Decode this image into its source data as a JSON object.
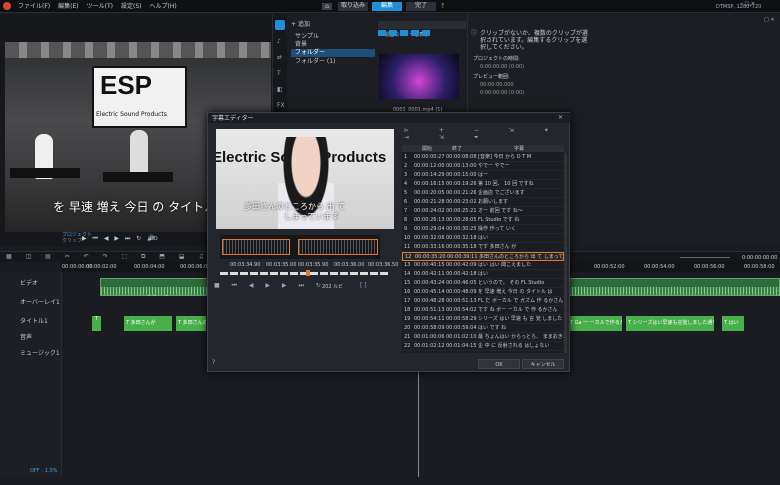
{
  "menu": {
    "items": [
      "ファイル(F)",
      "編集(E)",
      "ツール(T)",
      "設定(S)",
      "ヘルプ(H)"
    ],
    "tabs": [
      "取り込み",
      "編集",
      "完了"
    ],
    "project_info": "DTMSP, 1280*720"
  },
  "library": {
    "add_label": "追加",
    "items": [
      "サンプル",
      "背景",
      "フォルダー",
      "フォルダー (1)"
    ],
    "dropdown": "現在のビューを表示",
    "thumb_caption": "0001_0001.mp4 (1)"
  },
  "options": {
    "message": "クリップがないか、複数のクリップが選択されています。編集するクリップを選択してください。",
    "project_duration_label": "プロジェクトの時間:",
    "project_duration": "0:00:00:00 (0:00)",
    "preview_range_label": "プレビュー範囲:",
    "preview_in": "00:00:00.000",
    "preview_out": "0:00:00:00 (0:00)"
  },
  "preview": {
    "subtitle": "を 早速 増え 今日 の タイトル",
    "banner": "ESP",
    "banner_sub": "Electric Sound Products",
    "mode_a": "プロジェクト",
    "mode_b": "クリップ",
    "hd": "HD"
  },
  "dialog": {
    "title": "字幕エディター",
    "video_subtitle_line1": "多田さんのところから 出 て",
    "video_subtitle_line2": "しまっています",
    "video_logo": "Electric Sound Products",
    "wave_times": [
      "00:03:34.90",
      "00:03:35.00",
      "00:03:35.90",
      "00:03:36.00",
      "00:03:36.50"
    ],
    "current_time": "00:03:25.15",
    "count": "202 ルビ",
    "table": {
      "headers": [
        "開始",
        "終了",
        "字幕"
      ],
      "selected_index": 11,
      "rows": [
        [
          "1",
          "00:00:00:27",
          "00:00:08:08",
          "[音楽] 今日 から O T M"
        ],
        [
          "2",
          "00:00:12:00",
          "00:00:13:00",
          "やでー やでー"
        ],
        [
          "3",
          "00:00:14:29",
          "00:00:15:00",
          "はー"
        ],
        [
          "4",
          "00:00:16:15",
          "00:00:19:26",
          "第 10 回、 10 回 ですね"
        ],
        [
          "5",
          "00:00:20:05",
          "00:00:21:26",
          "企画店 でございます"
        ],
        [
          "6",
          "00:00:21:28",
          "00:00:23:02",
          "お願いします"
        ],
        [
          "7",
          "00:00:24:02",
          "00:00:25:21",
          "オー 前回 です ね～"
        ],
        [
          "8",
          "00:00:26:13",
          "00:00:28:05",
          "FL Studio です ね"
        ],
        [
          "9",
          "00:00:29:04",
          "00:00:30:25",
          "操作 作って いく"
        ],
        [
          "10",
          "00:00:32:06",
          "00:00:32:18",
          "はい"
        ],
        [
          "11",
          "00:00:33:16",
          "00:00:35:18",
          "です 多田さん が"
        ],
        [
          "12",
          "00:00:35:20",
          "00:00:39:11",
          "多田さんのところから 出 て しまっていま..."
        ],
        [
          "13",
          "00:00:40:15",
          "00:00:42:09",
          "はい はい 聞こえました"
        ],
        [
          "14",
          "00:00:42:11",
          "00:00:42:18",
          "はい"
        ],
        [
          "15",
          "00:00:43:24",
          "00:00:46:05",
          "というので。 その FL Studio"
        ],
        [
          "16",
          "00:00:45:14",
          "00:00:48:09",
          "を 早速 増え 今日 の タイトル は"
        ],
        [
          "17",
          "00:00:48:28",
          "00:00:51:13",
          "FL だ ボーカル で ガズム 作 るかさん"
        ],
        [
          "18",
          "00:00:51:13",
          "00:00:54:02",
          "です ね ボー ーカル で 作 るかさん"
        ],
        [
          "19",
          "00:00:54:11",
          "00:00:58:29",
          "シリーズ はい 早速 も 言 覚 しました 通りやっ..."
        ],
        [
          "20",
          "00:00:58:09",
          "00:00:59:04",
          "はい です ね"
        ],
        [
          "21",
          "00:01:00:06",
          "00:01:02:10",
          "最 ちょんはい からっとら、 ままおきまましょす..."
        ],
        [
          "22",
          "00:01:02:12",
          "00:01:04:15",
          "企 中 に 反射される はしょない"
        ]
      ]
    },
    "ok": "OK",
    "cancel": "キャンセル"
  },
  "timeline": {
    "ruler": [
      "00:00:00:00",
      "00:00:02:00",
      "00:00:04:00",
      "00:00:06:00",
      "00:00:08:00",
      "00:00:10:00",
      "00:00:12:00"
    ],
    "right_ruler": [
      "00:00:52:00",
      "00:00:54:00",
      "00:00:56:00",
      "00:00:58:00",
      "00:01:00:00"
    ],
    "timecode": "0:00:00:00:00",
    "clip_name": "20200921111201_0_000_cut.mp4",
    "tracks": [
      "ビデオ",
      "オーバーレイ1",
      "タイトル1",
      "音声",
      "ミュージック1"
    ],
    "title_clips": [
      "T",
      "T 多田さんが",
      "T 多田さんの",
      "T Ga 一 ーカルで作るかさん",
      "T シリーズはい早速も言覚しました通りやっ",
      "T はい"
    ],
    "bottom_label": "OFF - 1.0%"
  }
}
